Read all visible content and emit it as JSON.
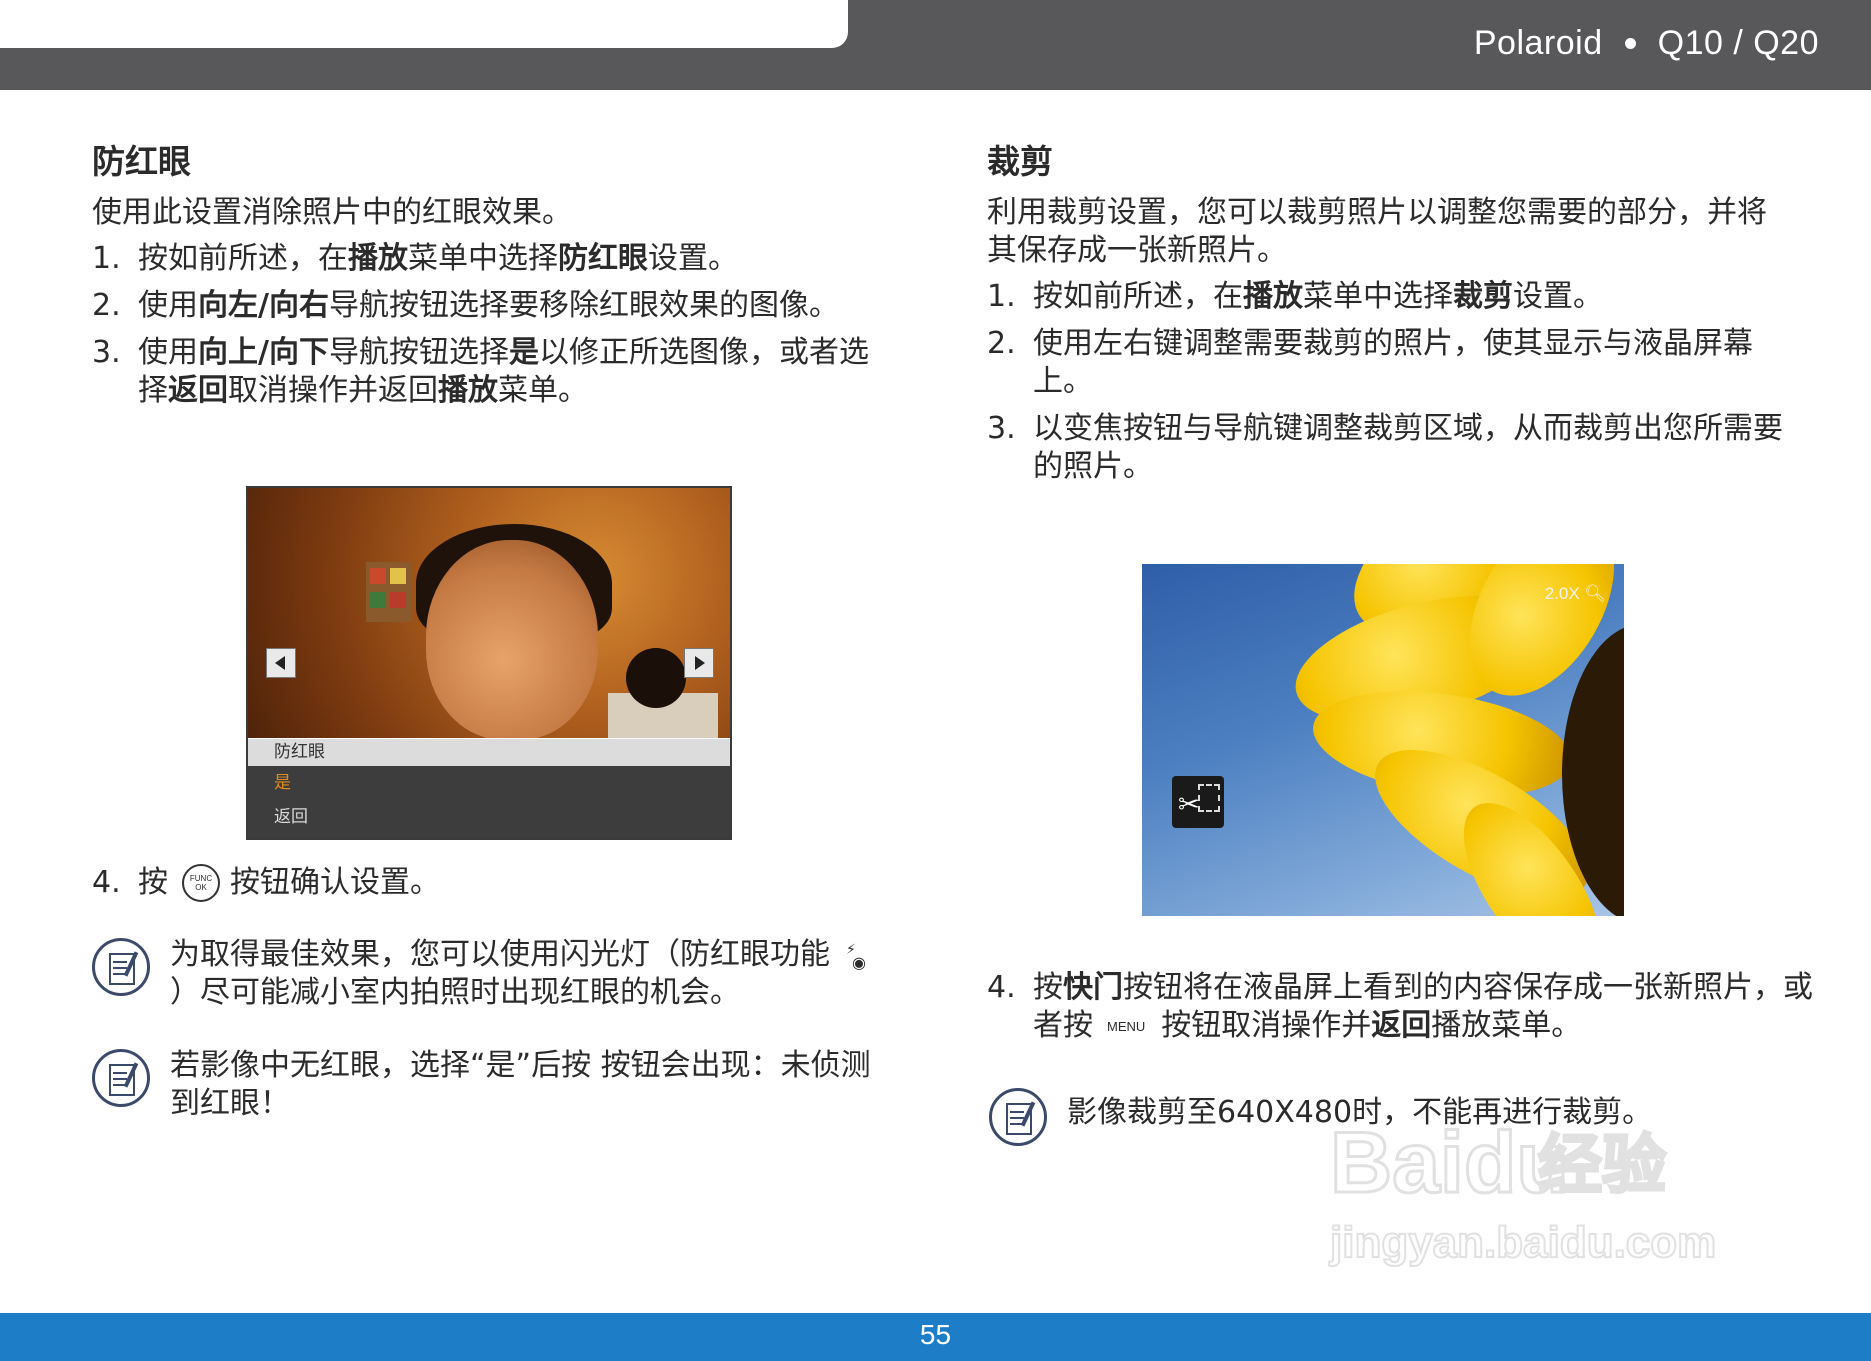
{
  "header": {
    "brand": "Polaroid",
    "model": "Q10 / Q20"
  },
  "footer": {
    "page_number": "55"
  },
  "left": {
    "title": "防红眼",
    "intro": "使用此设置消除照片中的红眼效果。",
    "steps": [
      {
        "num": "1.",
        "parts": [
          "按如前所述，在",
          "播放",
          "菜单中选择",
          "防红眼",
          "设置。"
        ]
      },
      {
        "num": "2.",
        "parts": [
          "使用",
          "向左/向右",
          "导航按钮选择要移除红眼效果的图像。"
        ]
      },
      {
        "num": "3.",
        "parts": [
          "使用",
          "向上/向下",
          "导航按钮选择",
          "是",
          "以修正所选图像，或者选择",
          "返回",
          "取消操作并返回",
          "播放",
          "菜单。"
        ]
      }
    ],
    "screen_menu": {
      "title": "防红眼",
      "yes": "是",
      "back": "返回"
    },
    "step4": {
      "num": "4.",
      "before": "按",
      "icon_top": "FUNC",
      "icon_bottom": "OK",
      "after": "按钮确认设置。"
    },
    "note1": {
      "before": "为取得最佳效果，您可以使用闪光灯（防红眼功能",
      "after": "）尽可能减小室内拍照时出现红眼的机会。"
    },
    "note2": "若影像中无红眼，选择“是”后按 按钮会出现：未侦测到红眼！"
  },
  "right": {
    "title": "裁剪",
    "intro": "利用裁剪设置，您可以裁剪照片以调整您需要的部分，并将其保存成一张新照片。",
    "steps": [
      {
        "num": "1.",
        "parts": [
          "按如前所述，在",
          "播放",
          "菜单中选择",
          "裁剪",
          "设置。"
        ]
      },
      {
        "num": "2.",
        "text": "使用左右键调整需要裁剪的照片，使其显示与液晶屏幕上。"
      },
      {
        "num": "3.",
        "text": "以变焦按钮与导航键调整裁剪区域，从而裁剪出您所需要的照片。"
      }
    ],
    "zoom": "2.0X",
    "step4": {
      "num": "4.",
      "p1": "按",
      "b1": "快门",
      "p2": "按钮将在液晶屏上看到的内容保存成一张新照片，或者按",
      "menu": "MENU",
      "p3": "按钮取消操作并",
      "b2": "返回",
      "p4": "播放菜单。"
    },
    "note": "影像裁剪至640X480时，不能再进行裁剪。"
  },
  "watermark": {
    "brand": "Baidu",
    "cn": "经验",
    "url": "jingyan.baidu.com"
  },
  "colors": {
    "header": "#58585a",
    "footer": "#1d7ec7",
    "menu_highlight": "#e08b1a"
  },
  "icons": {
    "note": "note-pencil-icon",
    "func_ok": "func-ok-button-icon",
    "flash": "flash-redeye-icon",
    "crop": "crop-scissors-icon",
    "zoom": "magnifier-icon"
  }
}
